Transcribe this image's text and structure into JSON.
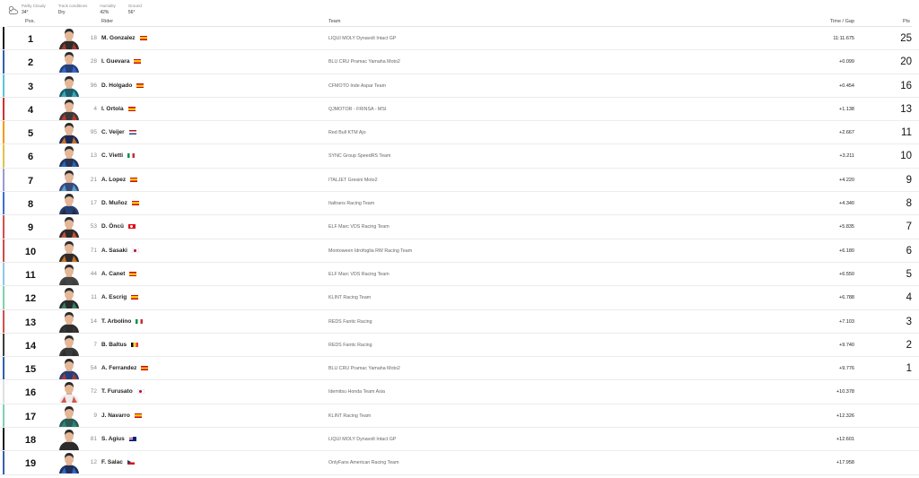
{
  "weather": [
    {
      "label": "Partly Cloudy",
      "value": "34°"
    },
    {
      "label": "Track conditions",
      "value": "Dry"
    },
    {
      "label": "Humidity",
      "value": "42%"
    },
    {
      "label": "Ground",
      "value": "56°"
    }
  ],
  "weather_icon": "partly-cloudy-icon",
  "headers": {
    "pos": "Pos.",
    "rider": "Rider",
    "team": "Team",
    "time": "Time / Gap",
    "pts": "Pts"
  },
  "rows": [
    {
      "pos": "1",
      "num": "18",
      "rider": "M. Gonzalez",
      "flag": "spain",
      "team": "LIQUI MOLY Dynavolt Intact GP",
      "time": "11:11.675",
      "pts": "25",
      "accent": "#1c1c1c",
      "helmet": "#c0392b",
      "suit": "#2c2c2c"
    },
    {
      "pos": "2",
      "num": "28",
      "rider": "I. Guevara",
      "flag": "spain",
      "team": "BLU CRU Pramac Yamaha Moto2",
      "time": "+0.099",
      "pts": "20",
      "accent": "#2f5fb0",
      "helmet": "#3a6fd8",
      "suit": "#24407a"
    },
    {
      "pos": "3",
      "num": "96",
      "rider": "D. Holgado",
      "flag": "spain",
      "team": "CFMOTO Inde Aspar Team",
      "time": "+0.454",
      "pts": "16",
      "accent": "#5ac6d6",
      "helmet": "#3fb6c8",
      "suit": "#1c5d6b"
    },
    {
      "pos": "4",
      "num": "4",
      "rider": "I. Ortola",
      "flag": "spain",
      "team": "QJMOTOR - FRINSA - MSI",
      "time": "+1.138",
      "pts": "13",
      "accent": "#d32f2f",
      "helmet": "#d33a2c",
      "suit": "#3a3a3a"
    },
    {
      "pos": "5",
      "num": "95",
      "rider": "C. Veijer",
      "flag": "netherlands",
      "team": "Red Bull KTM Ajo",
      "time": "+2.667",
      "pts": "11",
      "accent": "#f39c12",
      "helmet": "#e67e22",
      "suit": "#1b2a55"
    },
    {
      "pos": "6",
      "num": "13",
      "rider": "C. Vietti",
      "flag": "italy",
      "team": "SYNC Group SpeedRS Team",
      "time": "+3.211",
      "pts": "10",
      "accent": "#e3c24a",
      "helmet": "#2b6cd6",
      "suit": "#263552"
    },
    {
      "pos": "7",
      "num": "21",
      "rider": "A. Lopez",
      "flag": "spain",
      "team": "ITALJET Gresini Moto2",
      "time": "+4.220",
      "pts": "9",
      "accent": "#9a9ad6",
      "helmet": "#5bb0e0",
      "suit": "#3a4a7a"
    },
    {
      "pos": "8",
      "num": "17",
      "rider": "D. Muñoz",
      "flag": "spain",
      "team": "Italtrans Racing Team",
      "time": "+4.340",
      "pts": "8",
      "accent": "#3a6fd8",
      "helmet": "#2a2a2a",
      "suit": "#24407a"
    },
    {
      "pos": "9",
      "num": "53",
      "rider": "D. Öncü",
      "flag": "turkey",
      "team": "ELF Marc VDS Racing Team",
      "time": "+5.835",
      "pts": "7",
      "accent": "#d35050",
      "helmet": "#e25a3a",
      "suit": "#2a2a2a"
    },
    {
      "pos": "10",
      "num": "71",
      "rider": "A. Sasaki",
      "flag": "japan",
      "team": "Montoween Idrofoglia RW Racing Team",
      "time": "+6.180",
      "pts": "6",
      "accent": "#cf4b4b",
      "helmet": "#e67e22",
      "suit": "#2b2b2b"
    },
    {
      "pos": "11",
      "num": "44",
      "rider": "A. Canet",
      "flag": "spain",
      "team": "ELF Marc VDS Racing Team",
      "time": "+6.550",
      "pts": "5",
      "accent": "#8fc9e6",
      "helmet": "#3c3c3c",
      "suit": "#444444"
    },
    {
      "pos": "12",
      "num": "11",
      "rider": "A. Escrig",
      "flag": "spain",
      "team": "KLINT Racing Team",
      "time": "+6.788",
      "pts": "4",
      "accent": "#7fd0b0",
      "helmet": "#3a8f6a",
      "suit": "#2a2a2a"
    },
    {
      "pos": "13",
      "num": "14",
      "rider": "T. Arbolino",
      "flag": "italy",
      "team": "REDS Fantic Racing",
      "time": "+7.103",
      "pts": "3",
      "accent": "#d35050",
      "helmet": "#3a3a3a",
      "suit": "#2d2d2d"
    },
    {
      "pos": "14",
      "num": "7",
      "rider": "B. Baltus",
      "flag": "belgium",
      "team": "REDS Fantic Racing",
      "time": "+9.740",
      "pts": "2",
      "accent": "#3c3c3c",
      "helmet": "#2c2c2c",
      "suit": "#3a3a3a"
    },
    {
      "pos": "15",
      "num": "54",
      "rider": "A. Ferrandez",
      "flag": "spain",
      "team": "BLU CRU Pramac Yamaha Moto2",
      "time": "+9.776",
      "pts": "1",
      "accent": "#2f5fb0",
      "helmet": "#c0392b",
      "suit": "#24407a"
    },
    {
      "pos": "16",
      "num": "72",
      "rider": "T. Furusato",
      "flag": "japan",
      "team": "Idemitsu Honda Team Asia",
      "time": "+10.378",
      "pts": "",
      "accent": "#e0e0e0",
      "helmet": "#d33a2c",
      "suit": "#ededed"
    },
    {
      "pos": "17",
      "num": "9",
      "rider": "J. Navarro",
      "flag": "spain",
      "team": "KLINT Racing Team",
      "time": "+12.326",
      "pts": "",
      "accent": "#7fd0b0",
      "helmet": "#2f8f78",
      "suit": "#2a5a55"
    },
    {
      "pos": "18",
      "num": "81",
      "rider": "S. Agius",
      "flag": "australia",
      "team": "LIQUI MOLY Dynavolt Intact GP",
      "time": "+12.601",
      "pts": "",
      "accent": "#1c1c1c",
      "helmet": "#2c2c2c",
      "suit": "#2c2c2c"
    },
    {
      "pos": "19",
      "num": "12",
      "rider": "F. Salac",
      "flag": "czech",
      "team": "OnlyFans American Racing Team",
      "time": "+17.958",
      "pts": "",
      "accent": "#3a5fb0",
      "helmet": "#3a6fd8",
      "suit": "#1f2f5a"
    }
  ]
}
